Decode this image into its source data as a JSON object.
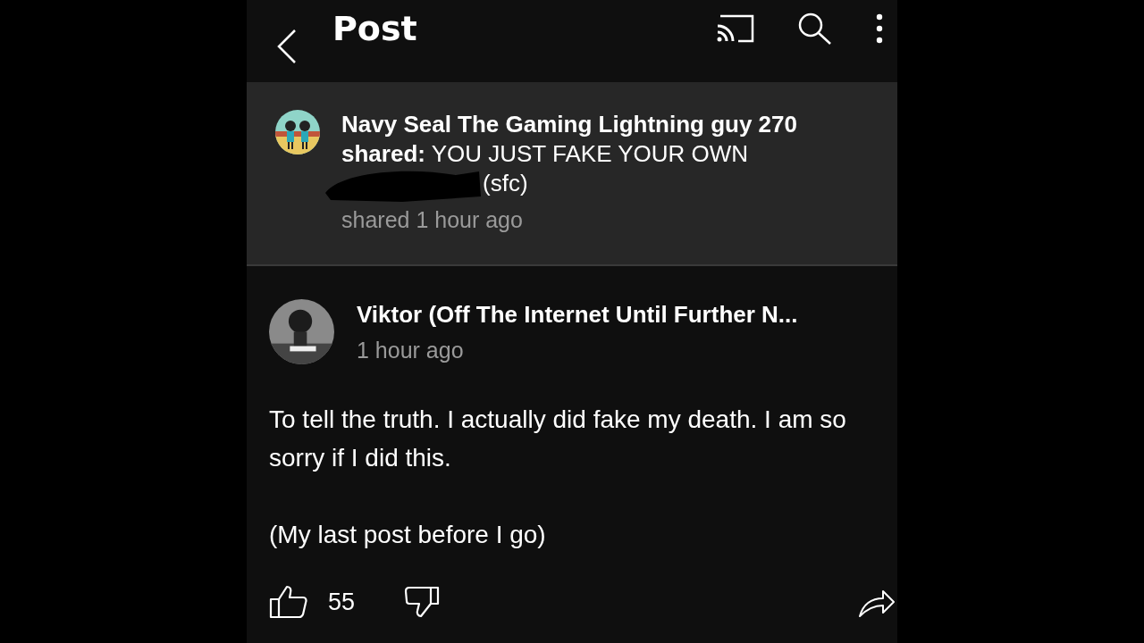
{
  "header": {
    "title": "Post"
  },
  "shared": {
    "text": "**Navy Seal The Gaming Lightning guy 270 shared:** YOU JUST FAKE YOUR OWN",
    "tail": "(sfc)",
    "time": "shared 1 hour ago"
  },
  "post": {
    "author": "Viktor (Off The Internet Until Further N...",
    "time": "1 hour ago",
    "paragraphs": [
      "To tell the truth. I actually did fake my death. I am so sorry if I did this.",
      "(My last post before I go)"
    ],
    "likes": "55"
  }
}
